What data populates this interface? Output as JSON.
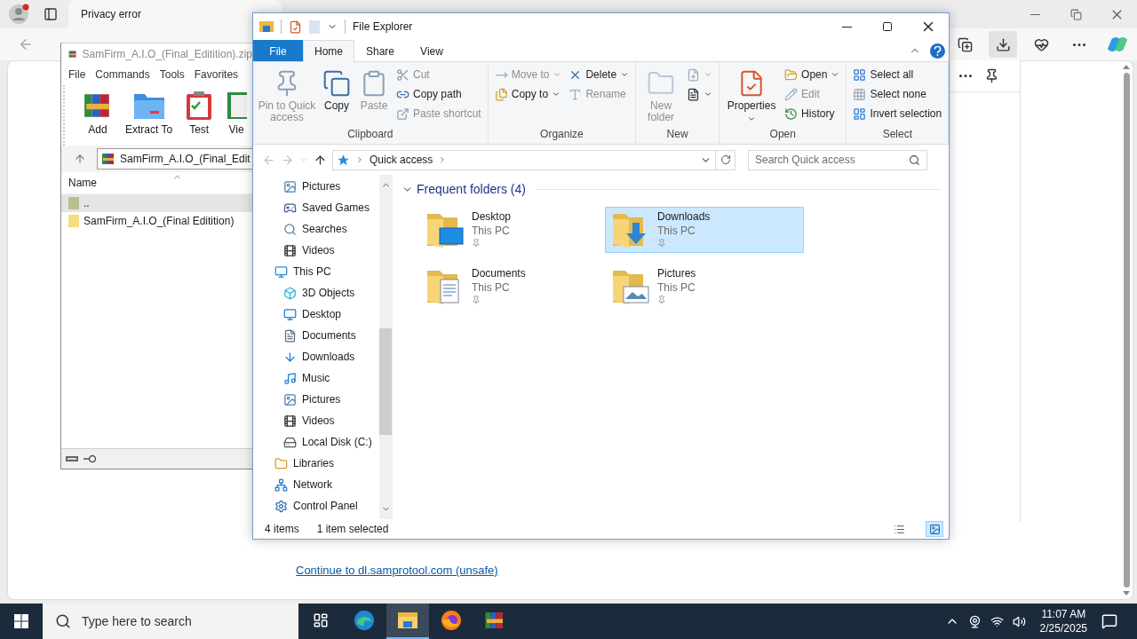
{
  "browser": {
    "tab": {
      "title": "Privacy error"
    },
    "link": "Continue to dl.samprotool.com (unsafe)"
  },
  "winrar": {
    "title": "SamFirm_A.I.O_(Final_Editition).zip",
    "menu": [
      "File",
      "Commands",
      "Tools",
      "Favorites"
    ],
    "tools": [
      {
        "label": "Add",
        "kind": "add"
      },
      {
        "label": "Extract To",
        "kind": "extract"
      },
      {
        "label": "Test",
        "kind": "test"
      },
      {
        "label": "Vie",
        "kind": "view"
      }
    ],
    "path": "SamFirm_A.I.O_(Final_Edit",
    "column": "Name",
    "rows": [
      {
        "name": "..",
        "kind": "parent",
        "selected": true
      },
      {
        "name": "SamFirm_A.I.O_(Final Editition)",
        "kind": "folder",
        "selected": false
      }
    ]
  },
  "explorer": {
    "title": "File Explorer",
    "tabs": [
      {
        "label": "File",
        "kind": "file",
        "selected": false
      },
      {
        "label": "Home",
        "kind": "tab",
        "selected": true
      },
      {
        "label": "Share",
        "kind": "tab",
        "selected": false
      },
      {
        "label": "View",
        "kind": "tab",
        "selected": false
      }
    ],
    "ribbon": {
      "groups": [
        {
          "name": "Clipboard",
          "columns": [
            [
              {
                "label": "Pin to Quick access",
                "kind": "large",
                "disabled": true,
                "dropdown": false
              }
            ],
            [
              {
                "label": "Copy",
                "kind": "large",
                "disabled": false,
                "dropdown": false
              }
            ],
            [
              {
                "label": "Paste",
                "kind": "large",
                "disabled": true,
                "dropdown": false
              }
            ],
            [
              {
                "label": "Cut",
                "kind": "small",
                "disabled": true,
                "dropdown": false
              },
              {
                "label": "Copy path",
                "kind": "small",
                "disabled": false,
                "dropdown": false
              },
              {
                "label": "Paste shortcut",
                "kind": "small",
                "disabled": true,
                "dropdown": false
              }
            ]
          ]
        },
        {
          "name": "Organize",
          "columns": [
            [
              {
                "label": "Move to",
                "kind": "small",
                "disabled": true,
                "dropdown": true
              },
              {
                "label": "Copy to",
                "kind": "small",
                "disabled": false,
                "dropdown": true
              }
            ],
            [
              {
                "label": "Delete",
                "kind": "small",
                "disabled": false,
                "dropdown": true
              },
              {
                "label": "Rename",
                "kind": "small",
                "disabled": true,
                "dropdown": false
              }
            ]
          ]
        },
        {
          "name": "New",
          "columns": [
            [
              {
                "label": "New folder",
                "kind": "large",
                "disabled": true,
                "dropdown": false
              }
            ],
            [
              {
                "kind": "small",
                "disabled": true,
                "dropdown": true
              },
              {
                "kind": "small",
                "disabled": false,
                "dropdown": true
              }
            ]
          ]
        },
        {
          "name": "Open",
          "columns": [
            [
              {
                "label": "Properties",
                "kind": "large",
                "disabled": false,
                "dropdown": true
              }
            ],
            [
              {
                "label": "Open",
                "kind": "small",
                "disabled": false,
                "dropdown": true
              },
              {
                "label": "Edit",
                "kind": "small",
                "disabled": true,
                "dropdown": false
              },
              {
                "label": "History",
                "kind": "small",
                "disabled": false,
                "dropdown": false
              }
            ]
          ]
        },
        {
          "name": "Select",
          "columns": [
            [
              {
                "label": "Select all",
                "kind": "small",
                "disabled": false,
                "dropdown": false
              },
              {
                "label": "Select none",
                "kind": "small",
                "disabled": false,
                "dropdown": false
              },
              {
                "label": "Invert selection",
                "kind": "small",
                "disabled": false,
                "dropdown": false
              }
            ]
          ]
        }
      ]
    },
    "address": {
      "back_disabled": true,
      "forward_disabled": true,
      "breadcrumb": [
        "Quick access"
      ],
      "search_placeholder": "Search Quick access"
    },
    "nav": {
      "continued": [
        {
          "label": "Pictures",
          "kind": "pictures"
        },
        {
          "label": "Saved Games",
          "kind": "games"
        },
        {
          "label": "Searches",
          "kind": "search"
        },
        {
          "label": "Videos",
          "kind": "videos"
        }
      ],
      "items": [
        {
          "label": "This PC",
          "kind": "pc",
          "children": [
            {
              "label": "3D Objects",
              "kind": "objects"
            },
            {
              "label": "Desktop",
              "kind": "desktop"
            },
            {
              "label": "Documents",
              "kind": "documents"
            },
            {
              "label": "Downloads",
              "kind": "downloads"
            },
            {
              "label": "Music",
              "kind": "music"
            },
            {
              "label": "Pictures",
              "kind": "pictures"
            },
            {
              "label": "Videos",
              "kind": "videos"
            },
            {
              "label": "Local Disk (C:)",
              "kind": "disk"
            }
          ]
        },
        {
          "label": "Libraries",
          "kind": "libraries"
        },
        {
          "label": "Network",
          "kind": "network"
        },
        {
          "label": "Control Panel",
          "kind": "control"
        }
      ]
    },
    "content": {
      "group": {
        "title": "Frequent folders (4)",
        "expanded": true,
        "tiles": [
          {
            "name": "Desktop",
            "location": "This PC",
            "kind": "desktop",
            "selected": false
          },
          {
            "name": "Downloads",
            "location": "This PC",
            "kind": "downloads",
            "selected": true
          },
          {
            "name": "Documents",
            "location": "This PC",
            "kind": "documents",
            "selected": false
          },
          {
            "name": "Pictures",
            "location": "This PC",
            "kind": "pictures",
            "selected": false
          }
        ]
      }
    },
    "status": {
      "count": "4 items",
      "selection": "1 item selected",
      "views": [
        {
          "kind": "details",
          "selected": false
        },
        {
          "kind": "tiles",
          "selected": true
        }
      ]
    }
  },
  "taskbar": {
    "search_placeholder": "Type here to search",
    "apps": [
      {
        "kind": "edge",
        "active": false
      },
      {
        "kind": "explorer",
        "active": true
      },
      {
        "kind": "firefox",
        "active": false
      },
      {
        "kind": "winrar",
        "active": false
      }
    ],
    "time": "11:07 AM",
    "date": "2/25/2025"
  }
}
